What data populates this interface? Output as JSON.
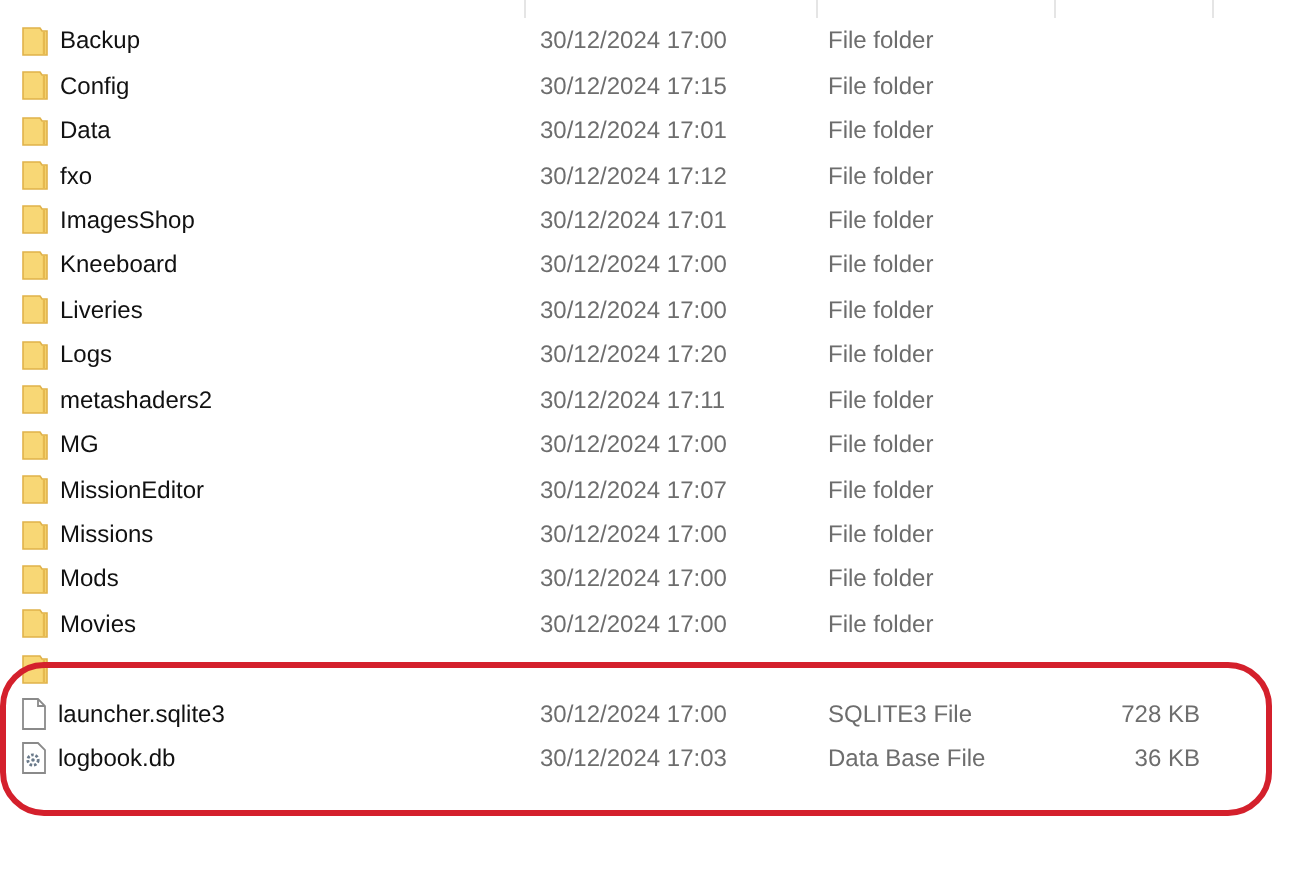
{
  "files": [
    {
      "kind": "folder",
      "name": "Backup",
      "date": "30/12/2024 17:00",
      "type": "File folder"
    },
    {
      "kind": "folder",
      "name": "Config",
      "date": "30/12/2024 17:15",
      "type": "File folder"
    },
    {
      "kind": "folder",
      "name": "Data",
      "date": "30/12/2024 17:01",
      "type": "File folder"
    },
    {
      "kind": "folder",
      "name": "fxo",
      "date": "30/12/2024 17:12",
      "type": "File folder"
    },
    {
      "kind": "folder",
      "name": "ImagesShop",
      "date": "30/12/2024 17:01",
      "type": "File folder"
    },
    {
      "kind": "folder",
      "name": "Kneeboard",
      "date": "30/12/2024 17:00",
      "type": "File folder"
    },
    {
      "kind": "folder",
      "name": "Liveries",
      "date": "30/12/2024 17:00",
      "type": "File folder"
    },
    {
      "kind": "folder",
      "name": "Logs",
      "date": "30/12/2024 17:20",
      "type": "File folder"
    },
    {
      "kind": "folder",
      "name": "metashaders2",
      "date": "30/12/2024 17:11",
      "type": "File folder"
    },
    {
      "kind": "folder",
      "name": "MG",
      "date": "30/12/2024 17:00",
      "type": "File folder"
    },
    {
      "kind": "folder",
      "name": "MissionEditor",
      "date": "30/12/2024 17:07",
      "type": "File folder"
    },
    {
      "kind": "folder",
      "name": "Missions",
      "date": "30/12/2024 17:00",
      "type": "File folder"
    },
    {
      "kind": "folder",
      "name": "Mods",
      "date": "30/12/2024 17:00",
      "type": "File folder"
    },
    {
      "kind": "folder",
      "name": "Movies",
      "date": "30/12/2024 17:00",
      "type": "File folder"
    },
    {
      "kind": "folder"
    },
    {
      "kind": "file",
      "name": "launcher.sqlite3",
      "date": "30/12/2024 17:00",
      "type": "SQLITE3 File",
      "size": "728 KB"
    },
    {
      "kind": "database",
      "name": "logbook.db",
      "date": "30/12/2024 17:03",
      "type": "Data Base File",
      "size": "36 KB"
    }
  ]
}
